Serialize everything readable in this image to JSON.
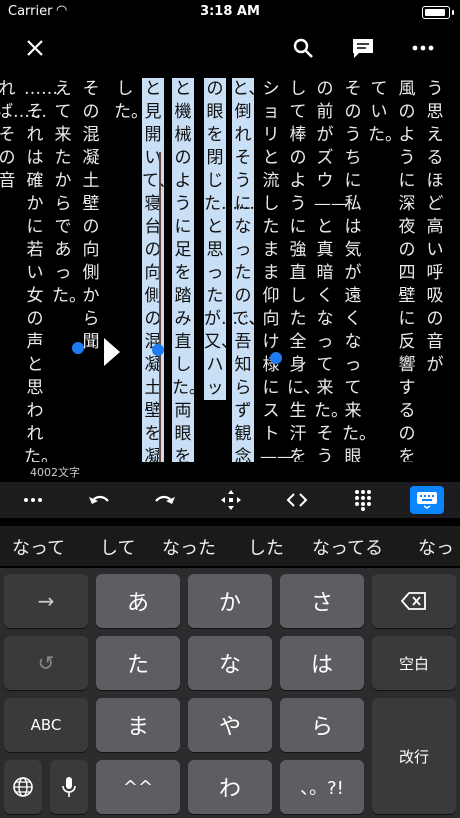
{
  "status": {
    "carrier": "Carrier",
    "time": "3:18 AM"
  },
  "reader": {
    "columns": [
      {
        "text": "う思えるほど高い呼吸の音が"
      },
      {
        "text": "風のように深夜の四壁に反響するのを聞い"
      },
      {
        "text": "ていた。"
      },
      {
        "text": "そのうちに私は気が遠くなって来た。眼"
      },
      {
        "text": "の前がズウ——と真暗くなって来た。そう"
      },
      {
        "text": "して棒のように強直した全身に、生汗をビッ"
      },
      {
        "text": "ショリと流したまま仰向け様にスト——ン"
      },
      {
        "text": "と、倒れそうになったので、吾知らず観念"
      },
      {
        "text": "の眼を閉じた……と思ったが……又、ハッ"
      },
      {
        "text": "と機械のように足を踏み直した。両眼をカッ"
      },
      {
        "text": "と見開いて、寝台の向側の混凝土壁を凝視"
      },
      {
        "text": "した。"
      },
      {
        "text": "その混凝土壁の向側から聞"
      },
      {
        "text": "えて来たからであった。"
      },
      {
        "text": "……それは確かに若い女の声と思われた。"
      },
      {
        "text": "れば……その音"
      }
    ],
    "char_count": "4002文字"
  },
  "candidates": [
    "なって",
    "して",
    "なった",
    "した",
    "なってる",
    "なっ"
  ],
  "keyboard": {
    "row1": [
      "→",
      "あ",
      "か",
      "さ"
    ],
    "row2": [
      "↺",
      "た",
      "な",
      "は"
    ],
    "row3": [
      "ABC",
      "ま",
      "や",
      "ら"
    ],
    "row4": [
      "^^",
      "わ",
      "、。?!"
    ],
    "space": "空白",
    "enter": "改行"
  }
}
